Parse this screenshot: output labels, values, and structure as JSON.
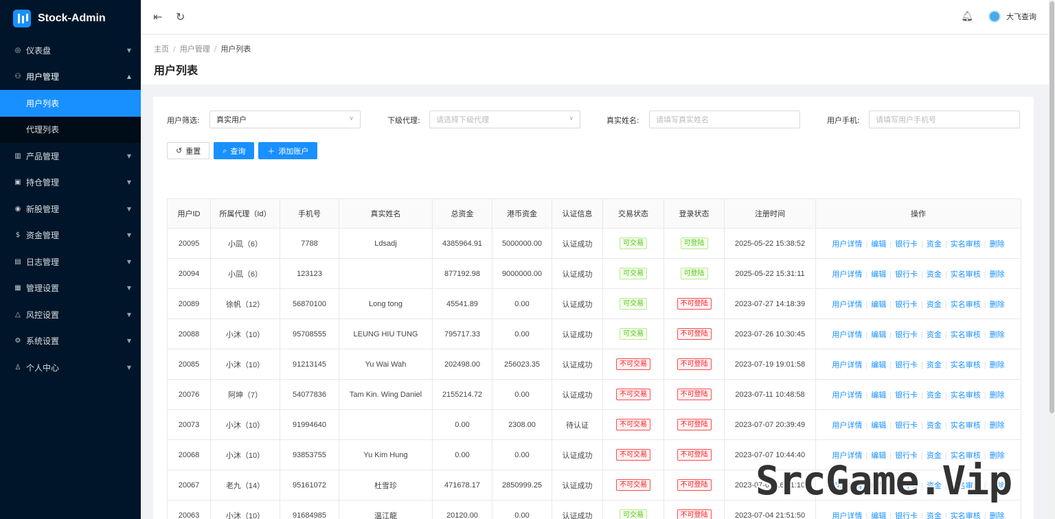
{
  "app": {
    "title": "Stock-Admin"
  },
  "sidebar": {
    "items": [
      {
        "label": "仪表盘",
        "icon": "dashboard-icon"
      },
      {
        "label": "用户管理",
        "icon": "user-manage-icon",
        "open": true,
        "children": [
          "用户列表",
          "代理列表"
        ]
      },
      {
        "label": "产品管理",
        "icon": "chart-icon"
      },
      {
        "label": "持仓管理",
        "icon": "position-icon"
      },
      {
        "label": "新股管理",
        "icon": "signal-icon"
      },
      {
        "label": "资金管理",
        "icon": "money-icon"
      },
      {
        "label": "日志管理",
        "icon": "log-icon"
      },
      {
        "label": "管理设置",
        "icon": "admin-settings-icon"
      },
      {
        "label": "风控设置",
        "icon": "warning-icon"
      },
      {
        "label": "系统设置",
        "icon": "gear-icon"
      },
      {
        "label": "个人中心",
        "icon": "person-icon"
      }
    ]
  },
  "header": {
    "user_name": "大飞查询"
  },
  "breadcrumb": [
    "主页",
    "用户管理",
    "用户列表"
  ],
  "page_title": "用户列表",
  "filters": {
    "user_filter": {
      "label": "用户筛选:",
      "value": "真实用户"
    },
    "agent": {
      "label": "下级代理:",
      "placeholder": "请选择下级代理"
    },
    "real_name": {
      "label": "真实姓名:",
      "placeholder": "请填写真实姓名"
    },
    "phone": {
      "label": "用户手机:",
      "placeholder": "请填写用户手机号"
    }
  },
  "buttons": {
    "reset": "重置",
    "query": "查询",
    "add": "添加账户"
  },
  "table": {
    "columns": [
      "用户ID",
      "所属代理（Id）",
      "手机号",
      "真实姓名",
      "总资金",
      "港币资金",
      "认证信息",
      "交易状态",
      "登录状态",
      "注册时间",
      "操作"
    ],
    "ops": [
      "用户详情",
      "编辑",
      "银行卡",
      "资金",
      "实名审核",
      "删除"
    ],
    "rows": [
      [
        "20095",
        "小凨（6）",
        "7788",
        "Ldsadj",
        "4385964.91",
        "5000000.00",
        "认证成功",
        "可交易",
        "可登陆",
        "2025-05-22 15:38:52"
      ],
      [
        "20094",
        "小凨（6）",
        "123123",
        "",
        "877192.98",
        "9000000.00",
        "认证成功",
        "可交易",
        "可登陆",
        "2025-05-22 15:31:11"
      ],
      [
        "20089",
        "徐帆（12）",
        "56870100",
        "Long tong",
        "45541.89",
        "0.00",
        "认证成功",
        "可交易",
        "不可登陆",
        "2023-07-27 14:18:39"
      ],
      [
        "20088",
        "小沐（10）",
        "95708555",
        "LEUNG HIU TUNG",
        "795717.33",
        "0.00",
        "认证成功",
        "可交易",
        "不可登陆",
        "2023-07-26 10:30:45"
      ],
      [
        "20085",
        "小沐（10）",
        "91213145",
        "Yu Wai Wah",
        "202498.00",
        "256023.35",
        "认证成功",
        "不可交易",
        "不可登陆",
        "2023-07-19 19:01:58"
      ],
      [
        "20076",
        "阿坤（7）",
        "54077836",
        "Tam Kin. Wing Daniel",
        "2155214.72",
        "0.00",
        "认证成功",
        "不可交易",
        "不可登陆",
        "2023-07-11 10:48:58"
      ],
      [
        "20073",
        "小沐（10）",
        "91994640",
        "",
        "0.00",
        "2308.00",
        "待认证",
        "不可交易",
        "不可登陆",
        "2023-07-07 20:39:49"
      ],
      [
        "20068",
        "小沐（10）",
        "93853755",
        "Yu Kim Hung",
        "0.00",
        "0.00",
        "认证成功",
        "不可交易",
        "不可登陆",
        "2023-07-07 10:44:40"
      ],
      [
        "20067",
        "老九（14）",
        "95161072",
        "杜雪珍",
        "471678.17",
        "2850999.25",
        "认证成功",
        "不可交易",
        "不可登陆",
        "2023-07-06 16:31:10"
      ],
      [
        "20063",
        "小沐（10）",
        "91684985",
        "温江龍",
        "20120.00",
        "0.00",
        "认证成功",
        "可交易",
        "不可登陆",
        "2023-07-04 21:51:50"
      ]
    ]
  },
  "watermark": "SrcGame.Vip"
}
